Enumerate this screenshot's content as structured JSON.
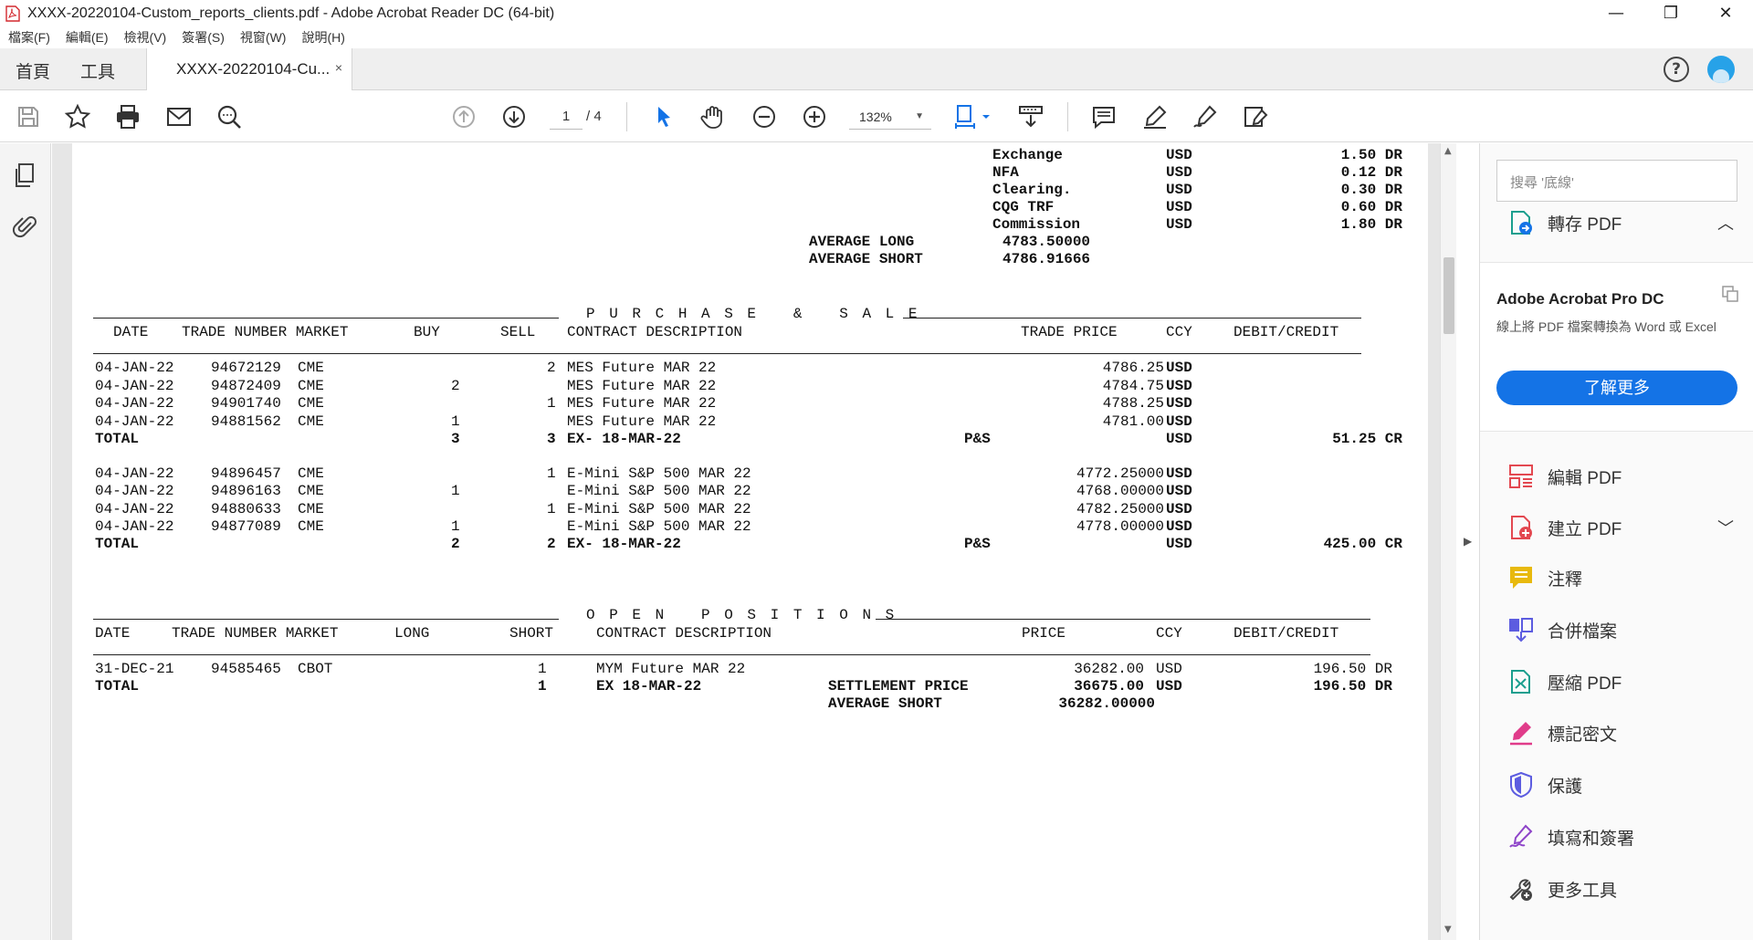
{
  "window": {
    "title": "XXXX-20220104-Custom_reports_clients.pdf - Adobe Acrobat Reader DC (64-bit)",
    "minimize": "—",
    "restore": "❐",
    "close": "✕"
  },
  "menu": [
    "檔案(F)",
    "編輯(E)",
    "檢視(V)",
    "簽署(S)",
    "視窗(W)",
    "說明(H)"
  ],
  "tabs": {
    "home": "首頁",
    "tools": "工具",
    "doc": "XXXX-20220104-Cu...",
    "close": "×"
  },
  "toolbar": {
    "page_current": "1",
    "page_total": "/ 4",
    "zoom": "132%",
    "zoom_caret": "▼"
  },
  "report": {
    "fees": [
      {
        "label": "Exchange",
        "ccy": "USD",
        "amount": "1.50 DR"
      },
      {
        "label": "NFA",
        "ccy": "USD",
        "amount": "0.12 DR"
      },
      {
        "label": "Clearing.",
        "ccy": "USD",
        "amount": "0.30 DR"
      },
      {
        "label": "CQG TRF",
        "ccy": "USD",
        "amount": "0.60 DR"
      },
      {
        "label": "Commission",
        "ccy": "USD",
        "amount": "1.80 DR"
      }
    ],
    "avg_long_label": "AVERAGE LONG",
    "avg_long_value": "4783.50000",
    "avg_short_label": "AVERAGE SHORT",
    "avg_short_value": "4786.91666",
    "purchase_sale": {
      "title": "P U R C H A S E   &   S A L E",
      "headers": {
        "date": "DATE",
        "trade_market": "TRADE NUMBER MARKET",
        "buy": "BUY",
        "sell": "SELL",
        "contract": "CONTRACT DESCRIPTION",
        "price": "TRADE PRICE",
        "ccy": "CCY",
        "debit_credit": "DEBIT/CREDIT"
      },
      "rows": [
        {
          "date": "04-JAN-22",
          "trade": "94672129",
          "market": "CME",
          "buy": "",
          "sell": "2",
          "contract": "MES Future MAR 22",
          "price": "4786.25",
          "ccy": "USD"
        },
        {
          "date": "04-JAN-22",
          "trade": "94872409",
          "market": "CME",
          "buy": "2",
          "sell": "",
          "contract": "MES Future MAR 22",
          "price": "4784.75",
          "ccy": "USD"
        },
        {
          "date": "04-JAN-22",
          "trade": "94901740",
          "market": "CME",
          "buy": "",
          "sell": "1",
          "contract": "MES Future MAR 22",
          "price": "4788.25",
          "ccy": "USD"
        },
        {
          "date": "04-JAN-22",
          "trade": "94881562",
          "market": "CME",
          "buy": "1",
          "sell": "",
          "contract": "MES Future MAR 22",
          "price": "4781.00",
          "ccy": "USD"
        },
        {
          "date": "TOTAL",
          "trade": "",
          "market": "",
          "buy": "3",
          "sell": "3",
          "contract": "EX- 18-MAR-22",
          "ps": "P&S",
          "ccy": "USD",
          "amount": "51.25 CR"
        },
        {
          "date": "04-JAN-22",
          "trade": "94896457",
          "market": "CME",
          "buy": "",
          "sell": "1",
          "contract": "E-Mini S&P 500 MAR 22",
          "price": "4772.25000",
          "ccy": "USD"
        },
        {
          "date": "04-JAN-22",
          "trade": "94896163",
          "market": "CME",
          "buy": "1",
          "sell": "",
          "contract": "E-Mini S&P 500 MAR 22",
          "price": "4768.00000",
          "ccy": "USD"
        },
        {
          "date": "04-JAN-22",
          "trade": "94880633",
          "market": "CME",
          "buy": "",
          "sell": "1",
          "contract": "E-Mini S&P 500 MAR 22",
          "price": "4782.25000",
          "ccy": "USD"
        },
        {
          "date": "04-JAN-22",
          "trade": "94877089",
          "market": "CME",
          "buy": "1",
          "sell": "",
          "contract": "E-Mini S&P 500 MAR 22",
          "price": "4778.00000",
          "ccy": "USD"
        },
        {
          "date": "TOTAL",
          "trade": "",
          "market": "",
          "buy": "2",
          "sell": "2",
          "contract": "EX- 18-MAR-22",
          "ps": "P&S",
          "ccy": "USD",
          "amount": "425.00 CR"
        }
      ]
    },
    "open_positions": {
      "title": "O P E N   P O S I T I O N S",
      "headers": {
        "date": "DATE",
        "trade_market": "TRADE NUMBER MARKET",
        "long": "LONG",
        "short": "SHORT",
        "contract": "CONTRACT DESCRIPTION",
        "price": "PRICE",
        "ccy": "CCY",
        "debit_credit": "DEBIT/CREDIT"
      },
      "row": {
        "date": "31-DEC-21",
        "trade": "94585465",
        "market": "CBOT",
        "short": "1",
        "contract": "MYM Future MAR 22",
        "price": "36282.00",
        "ccy": "USD",
        "amount": "196.50 DR"
      },
      "total": {
        "label": "TOTAL",
        "short": "1",
        "contract": "EX 18-MAR-22",
        "settle_label": "SETTLEMENT PRICE",
        "settle_value": "36675.00",
        "ccy": "USD",
        "amount": "196.50 DR"
      },
      "avg_short_label": "AVERAGE SHORT",
      "avg_short_value": "36282.00000"
    }
  },
  "right_panel": {
    "search_placeholder": "搜尋 '底線'",
    "export_pdf": "轉存 PDF",
    "promo_title": "Adobe Acrobat Pro DC",
    "promo_desc": "線上將 PDF 檔案轉換為 Word 或 Excel",
    "promo_button": "了解更多",
    "tools": [
      {
        "label": "編輯 PDF",
        "icon": "edit-pdf-icon",
        "color": "#e34850"
      },
      {
        "label": "建立 PDF",
        "icon": "create-pdf-icon",
        "color": "#e34850"
      },
      {
        "label": "注釋",
        "icon": "comment-icon",
        "color": "#e8b90d"
      },
      {
        "label": "合併檔案",
        "icon": "combine-files-icon",
        "color": "#5c5ce0"
      },
      {
        "label": "壓縮 PDF",
        "icon": "compress-pdf-icon",
        "color": "#1a9e8e"
      },
      {
        "label": "標記密文",
        "icon": "redact-icon",
        "color": "#e03c8a"
      },
      {
        "label": "保護",
        "icon": "protect-icon",
        "color": "#5c5ce0"
      },
      {
        "label": "填寫和簽署",
        "icon": "fill-sign-icon",
        "color": "#8e44c9"
      },
      {
        "label": "更多工具",
        "icon": "more-tools-icon",
        "color": "#444444"
      }
    ]
  },
  "colors": {
    "accent": "#1473e6",
    "avatar": "#27a2e8"
  }
}
